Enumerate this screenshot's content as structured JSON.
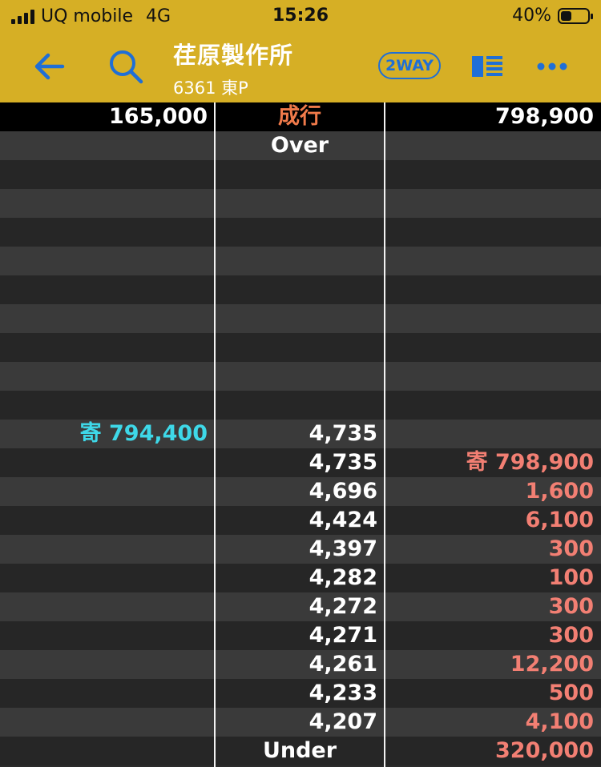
{
  "status_bar": {
    "carrier": "UQ mobile",
    "network": "4G",
    "time": "15:26",
    "battery": "40%"
  },
  "header": {
    "company": "荏原製作所",
    "code": "6361 東P",
    "two_way_label": "2WAY"
  },
  "colors": {
    "header_bg": "#d6af25",
    "accent_blue": "#1f6fd6",
    "bid_cyan": "#3ed8e8",
    "ask_salmon": "#f27f73",
    "market_orange": "#f07a4a"
  },
  "board": {
    "market_row": {
      "left": "165,000",
      "center": "成行",
      "right": "798,900"
    },
    "over_label": "Over",
    "under_label": "Under",
    "under_right": "320,000",
    "bid_row": {
      "price": "4,735",
      "qty": "寄 794,400"
    },
    "ask_rows": [
      {
        "price": "4,735",
        "qty": "寄 798,900"
      },
      {
        "price": "4,696",
        "qty": "1,600"
      },
      {
        "price": "4,424",
        "qty": "6,100"
      },
      {
        "price": "4,397",
        "qty": "300"
      },
      {
        "price": "4,282",
        "qty": "100"
      },
      {
        "price": "4,272",
        "qty": "300"
      },
      {
        "price": "4,271",
        "qty": "300"
      },
      {
        "price": "4,261",
        "qty": "12,200"
      },
      {
        "price": "4,233",
        "qty": "500"
      },
      {
        "price": "4,207",
        "qty": "4,100"
      }
    ]
  }
}
